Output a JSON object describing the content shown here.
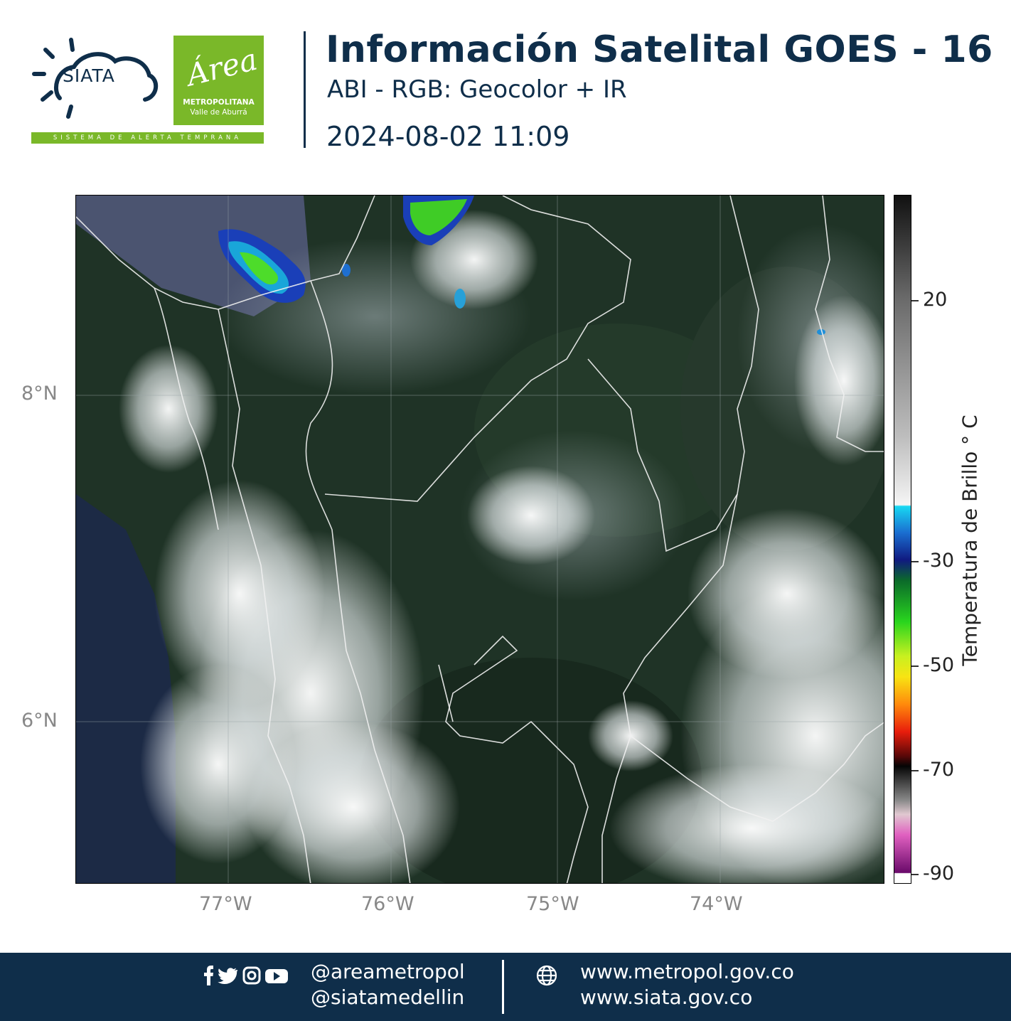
{
  "header": {
    "siata_word": "SIATA",
    "siata_band": "SISTEMA DE ALERTA TEMPRANA",
    "area_word": "Área",
    "area_sub1": "METROPOLITANA",
    "area_sub2": "Valle de Aburrá",
    "title": "Información Satelital GOES - 16",
    "subtitle": "ABI - RGB: Geocolor + IR",
    "datetime": "2024-08-02 11:09"
  },
  "map": {
    "lat_labels": [
      "8°N",
      "6°N"
    ],
    "lon_labels": [
      "77°W",
      "76°W",
      "75°W",
      "74°W"
    ]
  },
  "colorbar": {
    "title": "Temperatura de Brillo  ° C",
    "ticks": [
      "20",
      "-30",
      "-50",
      "-70",
      "-90"
    ],
    "range": [
      -90,
      30
    ]
  },
  "footer": {
    "handle_1": "@areametropol",
    "handle_2": "@siatamedellin",
    "web_1": "www.metropol.gov.co",
    "web_2": "www.siata.gov.co",
    "icons": [
      "facebook-icon",
      "twitter-icon",
      "instagram-icon",
      "youtube-icon",
      "globe-icon"
    ]
  },
  "colors": {
    "navy": "#0f2e4a",
    "green": "#7ab829"
  }
}
